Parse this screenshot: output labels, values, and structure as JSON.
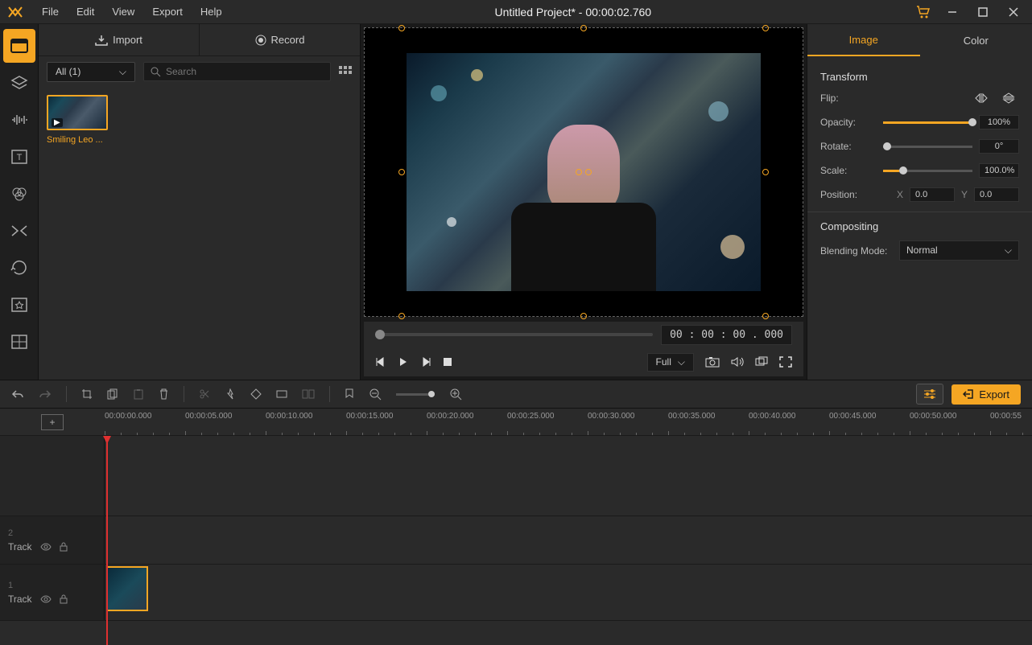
{
  "title": "Untitled Project* - 00:00:02.760",
  "menu": {
    "file": "File",
    "edit": "Edit",
    "view": "View",
    "export": "Export",
    "help": "Help"
  },
  "mediaPanel": {
    "importLabel": "Import",
    "recordLabel": "Record",
    "filterLabel": "All (1)",
    "searchPlaceholder": "Search",
    "items": [
      {
        "name": "Smiling Leo ..."
      }
    ]
  },
  "preview": {
    "time": "00 : 00 : 00 . 000",
    "sizeLabel": "Full"
  },
  "props": {
    "tabs": {
      "image": "Image",
      "color": "Color"
    },
    "transformLabel": "Transform",
    "flipLabel": "Flip:",
    "opacityLabel": "Opacity:",
    "opacityVal": "100%",
    "rotateLabel": "Rotate:",
    "rotateVal": "0°",
    "scaleLabel": "Scale:",
    "scaleVal": "100.0%",
    "positionLabel": "Position:",
    "posXLabel": "X",
    "posXVal": "0.0",
    "posYLabel": "Y",
    "posYVal": "0.0",
    "compositingLabel": "Compositing",
    "blendLabel": "Blending Mode:",
    "blendVal": "Normal"
  },
  "toolbar2": {
    "exportLabel": "Export"
  },
  "timeline": {
    "ticks": [
      "00:00:00.000",
      "00:00:05.000",
      "00:00:10.000",
      "00:00:15.000",
      "00:00:20.000",
      "00:00:25.000",
      "00:00:30.000",
      "00:00:35.000",
      "00:00:40.000",
      "00:00:45.000",
      "00:00:50.000",
      "00:00:55"
    ],
    "tracks": [
      {
        "num": "2",
        "label": "Track"
      },
      {
        "num": "1",
        "label": "Track"
      }
    ]
  }
}
